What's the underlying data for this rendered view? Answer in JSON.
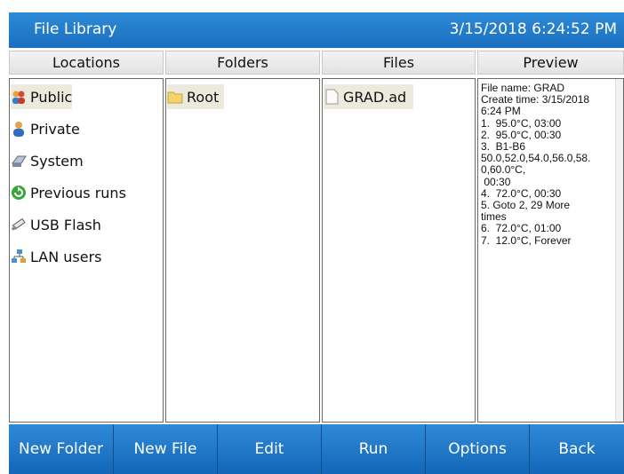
{
  "window": {
    "title": "File Library",
    "datetime": "3/15/2018 6:24:52 PM"
  },
  "headers": {
    "locations": "Locations",
    "folders": "Folders",
    "files": "Files",
    "preview": "Preview"
  },
  "locations": [
    {
      "label": "Public",
      "icon": "users-icon",
      "selected": true
    },
    {
      "label": "Private",
      "icon": "user-icon",
      "selected": false
    },
    {
      "label": "System",
      "icon": "disk-icon",
      "selected": false
    },
    {
      "label": "Previous runs",
      "icon": "refresh-icon",
      "selected": false
    },
    {
      "label": "USB Flash",
      "icon": "usb-icon",
      "selected": false
    },
    {
      "label": "LAN users",
      "icon": "network-icon",
      "selected": false
    }
  ],
  "folders": [
    {
      "label": "Root",
      "icon": "folder-icon",
      "selected": true
    }
  ],
  "files": [
    {
      "label": "GRAD.ad",
      "icon": "file-icon",
      "selected": true
    }
  ],
  "preview": {
    "text": "File name: GRAD\nCreate time: 3/15/2018\n6:24 PM\n1.  95.0°C, 03:00\n2.  95.0°C, 00:30\n3.  B1-B6\n50.0,52.0,54.0,56.0,58.\n0,60.0°C,\n 00:30\n4.  72.0°C, 00:30\n5. Goto 2, 29 More\ntimes\n6.  72.0°C, 01:00\n7.  12.0°C, Forever"
  },
  "toolbar": {
    "new_folder": "New Folder",
    "new_file": "New File",
    "edit": "Edit",
    "run": "Run",
    "options": "Options",
    "back": "Back"
  },
  "colors": {
    "title_bar": "#1e78c8",
    "selection": "#ece9dd",
    "toolbar": "#1d72c2"
  }
}
